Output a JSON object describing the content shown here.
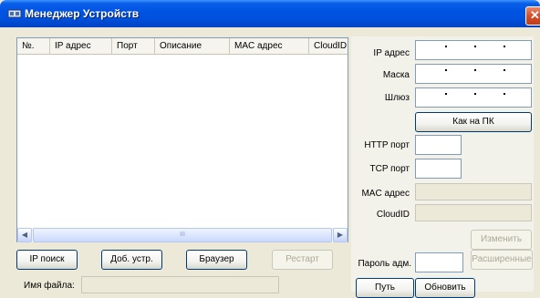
{
  "window": {
    "title": "Менеджер Устройств",
    "close_glyph": "✕",
    "accent": "#0054E3"
  },
  "device_table": {
    "columns": [
      "№.",
      "IP адрес",
      "Порт",
      "Описание",
      "MAC адрес",
      "CloudID"
    ],
    "rows": [],
    "scroll_left": "◀",
    "scroll_right": "▶",
    "thumb_grip": "III"
  },
  "network": {
    "ip_label": "IP адрес",
    "mask_label": "Маска",
    "gateway_label": "Шлюз",
    "ip_value": "",
    "mask_value": "",
    "gateway_value": "",
    "same_as_pc_label": "Как на ПК"
  },
  "ports": {
    "http_label": "HTTP порт",
    "tcp_label": "TCP порт",
    "http_value": "",
    "tcp_value": ""
  },
  "identity": {
    "mac_label": "MAC адрес",
    "cloudid_label": "CloudID",
    "mac_value": "",
    "cloudid_value": ""
  },
  "actions": {
    "change_label": "Изменить",
    "admin_password_label": "Пароль адм.",
    "admin_password_value": "",
    "advanced_label": "Расширенные",
    "ip_search_label": "IP поиск",
    "add_device_label": "Доб. устр.",
    "browser_label": "Браузер",
    "restart_label": "Рестарт",
    "filename_label": "Имя файла:",
    "filename_value": "",
    "path_label": "Путь",
    "update_label": "Обновить"
  },
  "icons": {
    "title": "device-manager-icon",
    "close": "close-icon",
    "scroll_left": "arrow-left-icon",
    "scroll_right": "arrow-right-icon"
  }
}
